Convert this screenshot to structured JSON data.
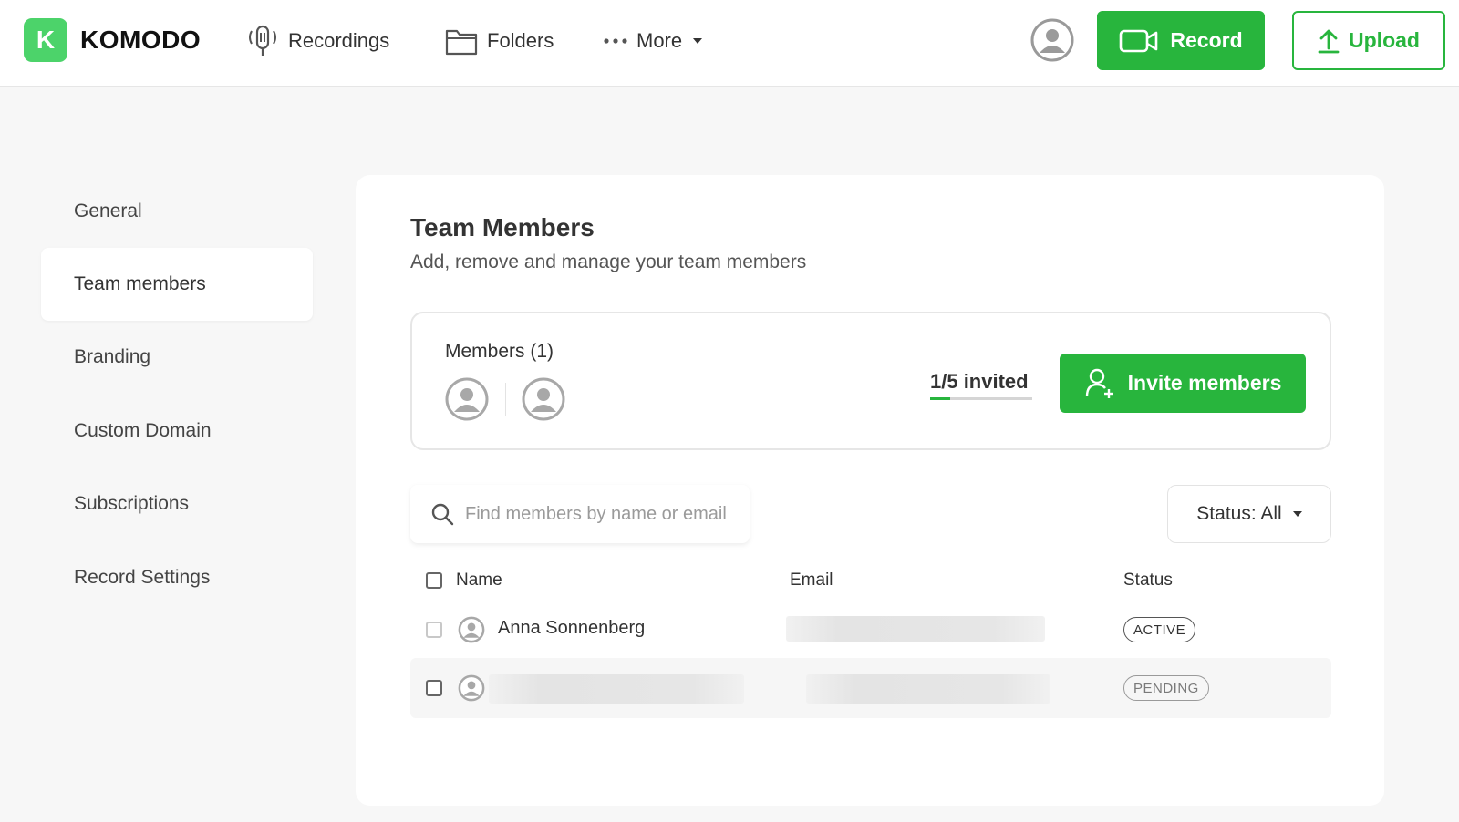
{
  "brand": {
    "logo_letter": "K",
    "name": "KOMODO",
    "accent_color": "#28b53d"
  },
  "nav": {
    "recordings": {
      "label": "Recordings",
      "icon": "microphone-icon"
    },
    "folders": {
      "label": "Folders",
      "icon": "folder-icon"
    },
    "more": {
      "label": "More",
      "icon": "ellipsis-icon"
    }
  },
  "header": {
    "record_label": "Record",
    "upload_label": "Upload"
  },
  "sidebar": {
    "items": [
      {
        "label": "General",
        "active": false
      },
      {
        "label": "Team members",
        "active": true
      },
      {
        "label": "Branding",
        "active": false
      },
      {
        "label": "Custom Domain",
        "active": false
      },
      {
        "label": "Subscriptions",
        "active": false
      },
      {
        "label": "Record Settings",
        "active": false
      }
    ]
  },
  "main": {
    "title": "Team Members",
    "subtitle": "Add, remove and manage your team members",
    "members": {
      "label": "Members (1)",
      "invited_text": "1/5 invited",
      "invited_fraction": 0.2,
      "invite_label": "Invite members"
    },
    "search": {
      "placeholder": "Find members by name or email",
      "value": ""
    },
    "status_filter": {
      "label": "Status: All"
    },
    "table": {
      "headers": {
        "name": "Name",
        "email": "Email",
        "status": "Status"
      },
      "rows": [
        {
          "name": "Anna Sonnenberg",
          "email": "",
          "status": "ACTIVE"
        },
        {
          "name": "",
          "email": "",
          "status": "PENDING"
        }
      ]
    }
  }
}
